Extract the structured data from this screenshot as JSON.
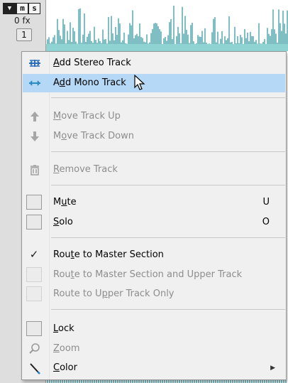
{
  "track_header": {
    "dropdown_label": "▼",
    "mute_label": "m",
    "solo_label": "s",
    "fx_label": "0 fx",
    "track_number": "1"
  },
  "menu": {
    "items": [
      {
        "label": "Add Stereo Track",
        "mnemonic": "A",
        "icon": "stereo-track-icon",
        "enabled": true
      },
      {
        "label": "Add Mono Track",
        "mnemonic": "d",
        "icon": "mono-track-icon",
        "enabled": true,
        "highlighted": true
      },
      {
        "label": "Move Track Up",
        "mnemonic": "M",
        "icon": "arrow-up-icon",
        "enabled": false
      },
      {
        "label": "Move Track Down",
        "mnemonic": "o",
        "icon": "arrow-down-icon",
        "enabled": false
      },
      {
        "label": "Remove Track",
        "mnemonic": "R",
        "icon": "trash-icon",
        "enabled": false
      },
      {
        "label": "Mute",
        "mnemonic": "u",
        "shortcut": "U",
        "checkbox": false,
        "enabled": true
      },
      {
        "label": "Solo",
        "mnemonic": "S",
        "shortcut": "O",
        "checkbox": false,
        "enabled": true
      },
      {
        "label": "Route to Master Section",
        "mnemonic": "t",
        "checked": true,
        "enabled": true
      },
      {
        "label": "Route to Master Section and Upper Track",
        "mnemonic": "t",
        "checkbox": false,
        "enabled": false
      },
      {
        "label": "Route to Upper Track Only",
        "mnemonic": "p",
        "checkbox": false,
        "enabled": false
      },
      {
        "label": "Lock",
        "mnemonic": "L",
        "checkbox": false,
        "enabled": true
      },
      {
        "label": "Zoom",
        "mnemonic": "Z",
        "icon": "magnifier-icon",
        "enabled": false
      },
      {
        "label": "Color",
        "mnemonic": "C",
        "icon": "color-pen-icon",
        "enabled": true,
        "submenu": true
      }
    ],
    "submenu_arrow": "▶"
  },
  "colors": {
    "waveform": "#3a9aa0",
    "waveform_fill": "#8fd4d2",
    "highlight": "#b5d8f6",
    "disabled_text": "#8d8d8d"
  }
}
